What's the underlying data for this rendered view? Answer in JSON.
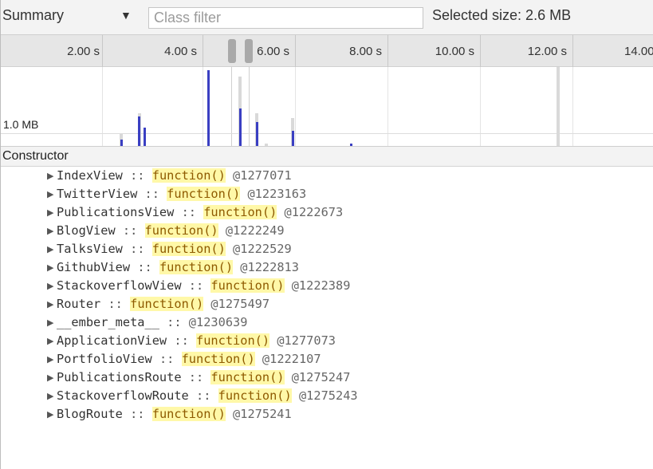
{
  "toolbar": {
    "view_label": "Summary",
    "view_dropdown_icon": "triangle-down-icon",
    "filter_placeholder": "Class filter",
    "filter_value": "",
    "selected_size": "Selected size: 2.6 MB"
  },
  "timeline": {
    "ticks": [
      "2.00 s",
      "4.00 s",
      "6.00 s",
      "8.00 s",
      "10.00 s",
      "12.00 s",
      "14.00"
    ],
    "size_label": "1.0 MB"
  },
  "constructor": {
    "header": "Constructor",
    "expand_icon": "triangle-right-icon",
    "rows": [
      {
        "name": "IndexView",
        "sep": " :: ",
        "fn": "function()",
        "id": " @1277071"
      },
      {
        "name": "TwitterView",
        "sep": " :: ",
        "fn": "function()",
        "id": " @1223163"
      },
      {
        "name": "PublicationsView",
        "sep": " :: ",
        "fn": "function()",
        "id": " @1222673"
      },
      {
        "name": "BlogView",
        "sep": " :: ",
        "fn": "function()",
        "id": " @1222249"
      },
      {
        "name": "TalksView",
        "sep": " :: ",
        "fn": "function()",
        "id": " @1222529"
      },
      {
        "name": "GithubView",
        "sep": " :: ",
        "fn": "function()",
        "id": " @1222813"
      },
      {
        "name": "StackoverflowView",
        "sep": " :: ",
        "fn": "function()",
        "id": " @1222389"
      },
      {
        "name": "Router",
        "sep": " :: ",
        "fn": "function()",
        "id": " @1275497"
      },
      {
        "name": "__ember_meta__",
        "sep": " :: ",
        "fn": "",
        "id": "@1230639"
      },
      {
        "name": "ApplicationView",
        "sep": " :: ",
        "fn": "function()",
        "id": " @1277073"
      },
      {
        "name": "PortfolioView",
        "sep": " :: ",
        "fn": "function()",
        "id": " @1222107"
      },
      {
        "name": "PublicationsRoute",
        "sep": " :: ",
        "fn": "function()",
        "id": " @1275247"
      },
      {
        "name": "StackoverflowRoute",
        "sep": " :: ",
        "fn": "function()",
        "id": " @1275243"
      },
      {
        "name": "BlogRoute",
        "sep": " :: ",
        "fn": "function()",
        "id": " @1275241"
      }
    ]
  }
}
